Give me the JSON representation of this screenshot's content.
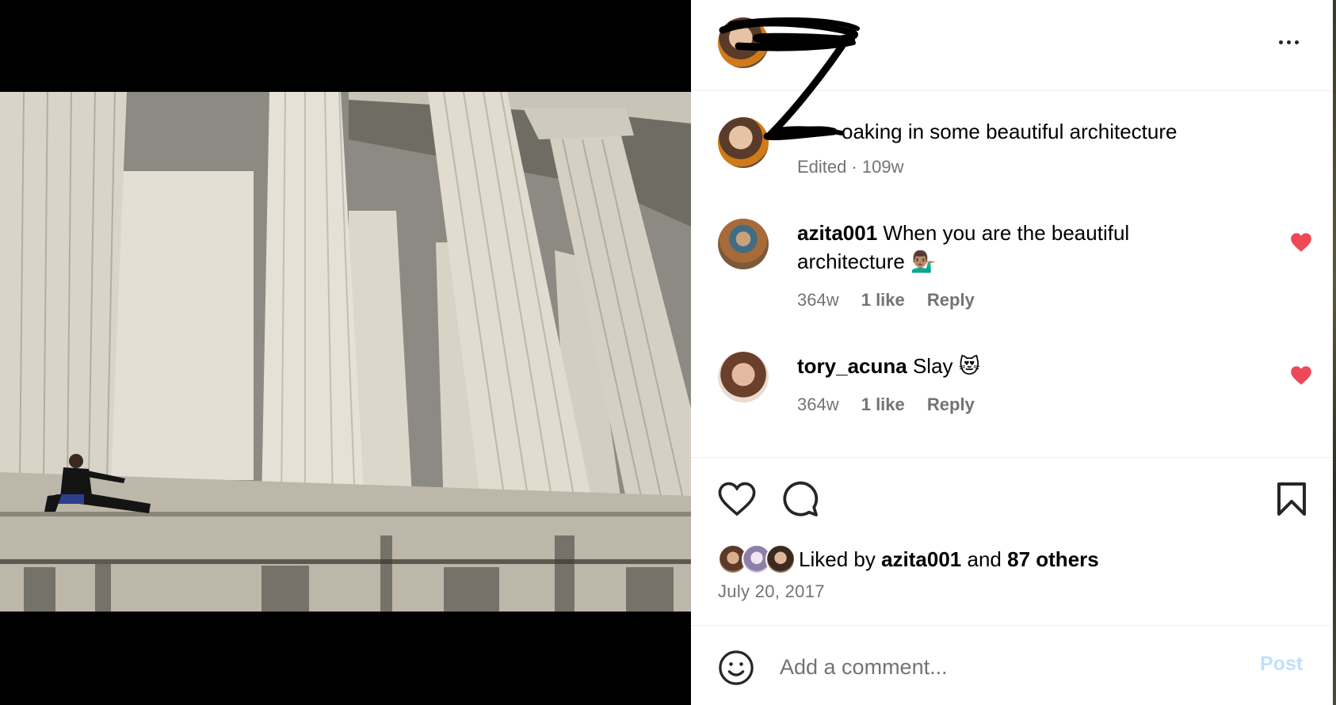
{
  "post": {
    "caption_visible": "oaking in some beautiful architecture",
    "caption_meta": "Edited · 109w"
  },
  "comments": [
    {
      "username": "azita001",
      "text": "When you are the beautiful architecture 💁🏽‍♂️",
      "age": "364w",
      "likes": "1 like",
      "reply": "Reply"
    },
    {
      "username": "tory_acuna",
      "text": "Slay 😻",
      "age": "364w",
      "likes": "1 like",
      "reply": "Reply"
    }
  ],
  "likes": {
    "prefix": "Liked by",
    "user": "azita001",
    "joiner": "and",
    "others": "87 others"
  },
  "date": "July 20, 2017",
  "comment_box": {
    "placeholder": "Add a comment...",
    "post_label": "Post"
  },
  "colors": {
    "like_red": "#ed4956",
    "muted": "#737373",
    "post_disabled": "#c0dffd"
  },
  "icons": {
    "more": "more-options-icon",
    "heart": "heart-icon",
    "comment": "comment-icon",
    "bookmark": "bookmark-icon",
    "emoji": "emoji-icon"
  }
}
